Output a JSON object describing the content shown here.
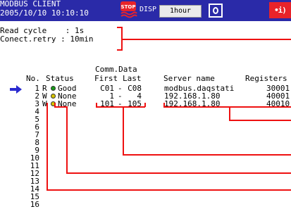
{
  "header": {
    "title": "MODBUS CLIENT",
    "datetime": "2005/10/10 10:10:10",
    "stop_icon_label": "STOP",
    "disp_label": "DISP",
    "period": "1hour",
    "alarm_badge": "•i)"
  },
  "settings": {
    "read_cycle": "Read cycle    : 1s",
    "conect_retry": "Conect.retry : 10min"
  },
  "table": {
    "group_header": "Comm.Data",
    "headers": {
      "no": "No.",
      "status": "Status",
      "first": "First",
      "last": "Last",
      "server": "Server name",
      "registers": "Registers"
    },
    "rows": [
      {
        "no": "1",
        "mode": "R",
        "status": "Good",
        "first": "C01",
        "dash": "-",
        "last": "C08",
        "server": "modbus.daqstati",
        "registers": "30001"
      },
      {
        "no": "2",
        "mode": "W",
        "status": "None",
        "first": "1",
        "dash": "-",
        "last": "4",
        "server": "192.168.1.80",
        "registers": "40001"
      },
      {
        "no": "3",
        "mode": "W",
        "status": "None",
        "first": "101",
        "dash": "-",
        "last": "105",
        "server": "192.168.1.80",
        "registers": "40010"
      },
      {
        "no": "4"
      },
      {
        "no": "5"
      },
      {
        "no": "6"
      },
      {
        "no": "7"
      },
      {
        "no": "8"
      },
      {
        "no": "9"
      },
      {
        "no": "10"
      },
      {
        "no": "11"
      },
      {
        "no": "12"
      },
      {
        "no": "13"
      },
      {
        "no": "14"
      },
      {
        "no": "15"
      },
      {
        "no": "16"
      }
    ],
    "selected_row": "1"
  },
  "colors": {
    "header_bg": "#2a2aa8",
    "good": "#1a9a1a",
    "none": "#d6c400",
    "annotation": "#e11111",
    "alarm": "#e8232a",
    "cursor": "#2a2ad0"
  }
}
